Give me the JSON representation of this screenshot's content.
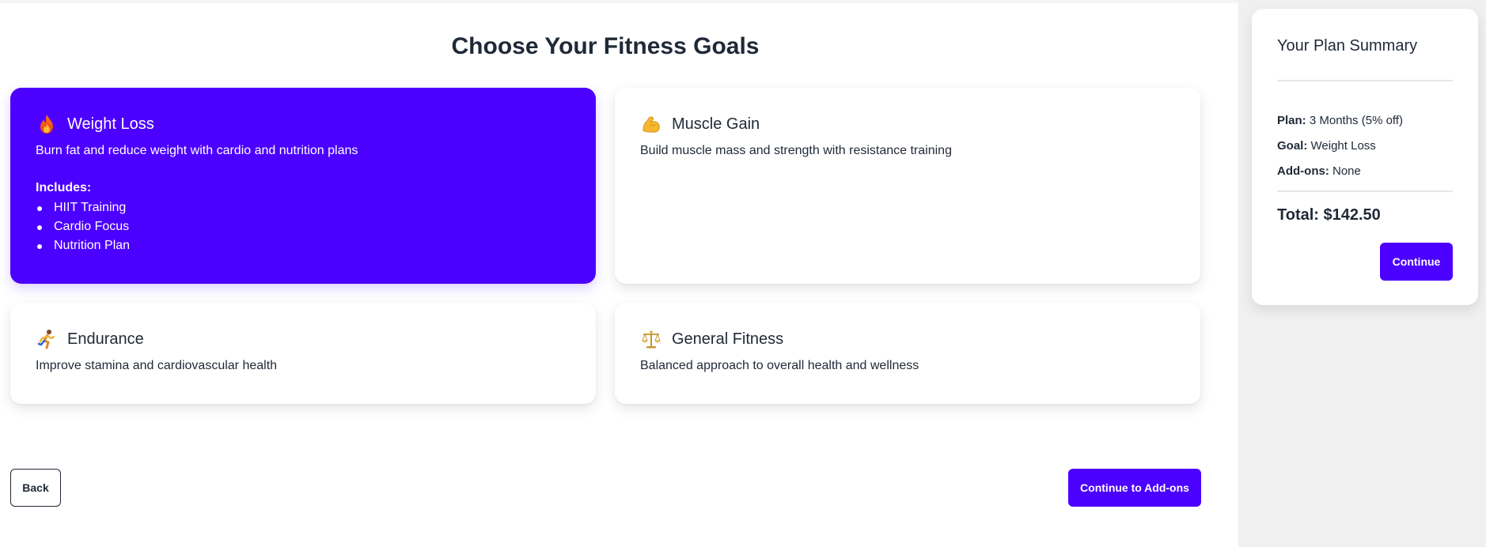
{
  "page": {
    "title": "Choose Your Fitness Goals"
  },
  "goals": [
    {
      "title": "Weight Loss",
      "icon": "fire-icon",
      "description": "Burn fat and reduce weight with cardio and nutrition plans",
      "selected": true,
      "includes_label": "Includes:",
      "includes": [
        "HIIT Training",
        "Cardio Focus",
        "Nutrition Plan"
      ]
    },
    {
      "title": "Muscle Gain",
      "icon": "flexed-biceps-icon",
      "description": "Build muscle mass and strength with resistance training",
      "selected": false
    },
    {
      "title": "Endurance",
      "icon": "running-person-icon",
      "description": "Improve stamina and cardiovascular health",
      "selected": false
    },
    {
      "title": "General Fitness",
      "icon": "balance-scale-icon",
      "description": "Balanced approach to overall health and wellness",
      "selected": false
    }
  ],
  "navigation": {
    "back_label": "Back",
    "continue_label": "Continue to Add-ons"
  },
  "summary": {
    "title": "Your Plan Summary",
    "plan_label": "Plan:",
    "plan_value": "3 Months (5% off)",
    "goal_label": "Goal:",
    "goal_value": "Weight Loss",
    "addons_label": "Add-ons:",
    "addons_value": "None",
    "total": "Total: $142.50",
    "continue_label": "Continue"
  },
  "colors": {
    "accent": "#4c00ff",
    "text": "#1f2937",
    "sidebar_bg": "#f0f0f0"
  }
}
